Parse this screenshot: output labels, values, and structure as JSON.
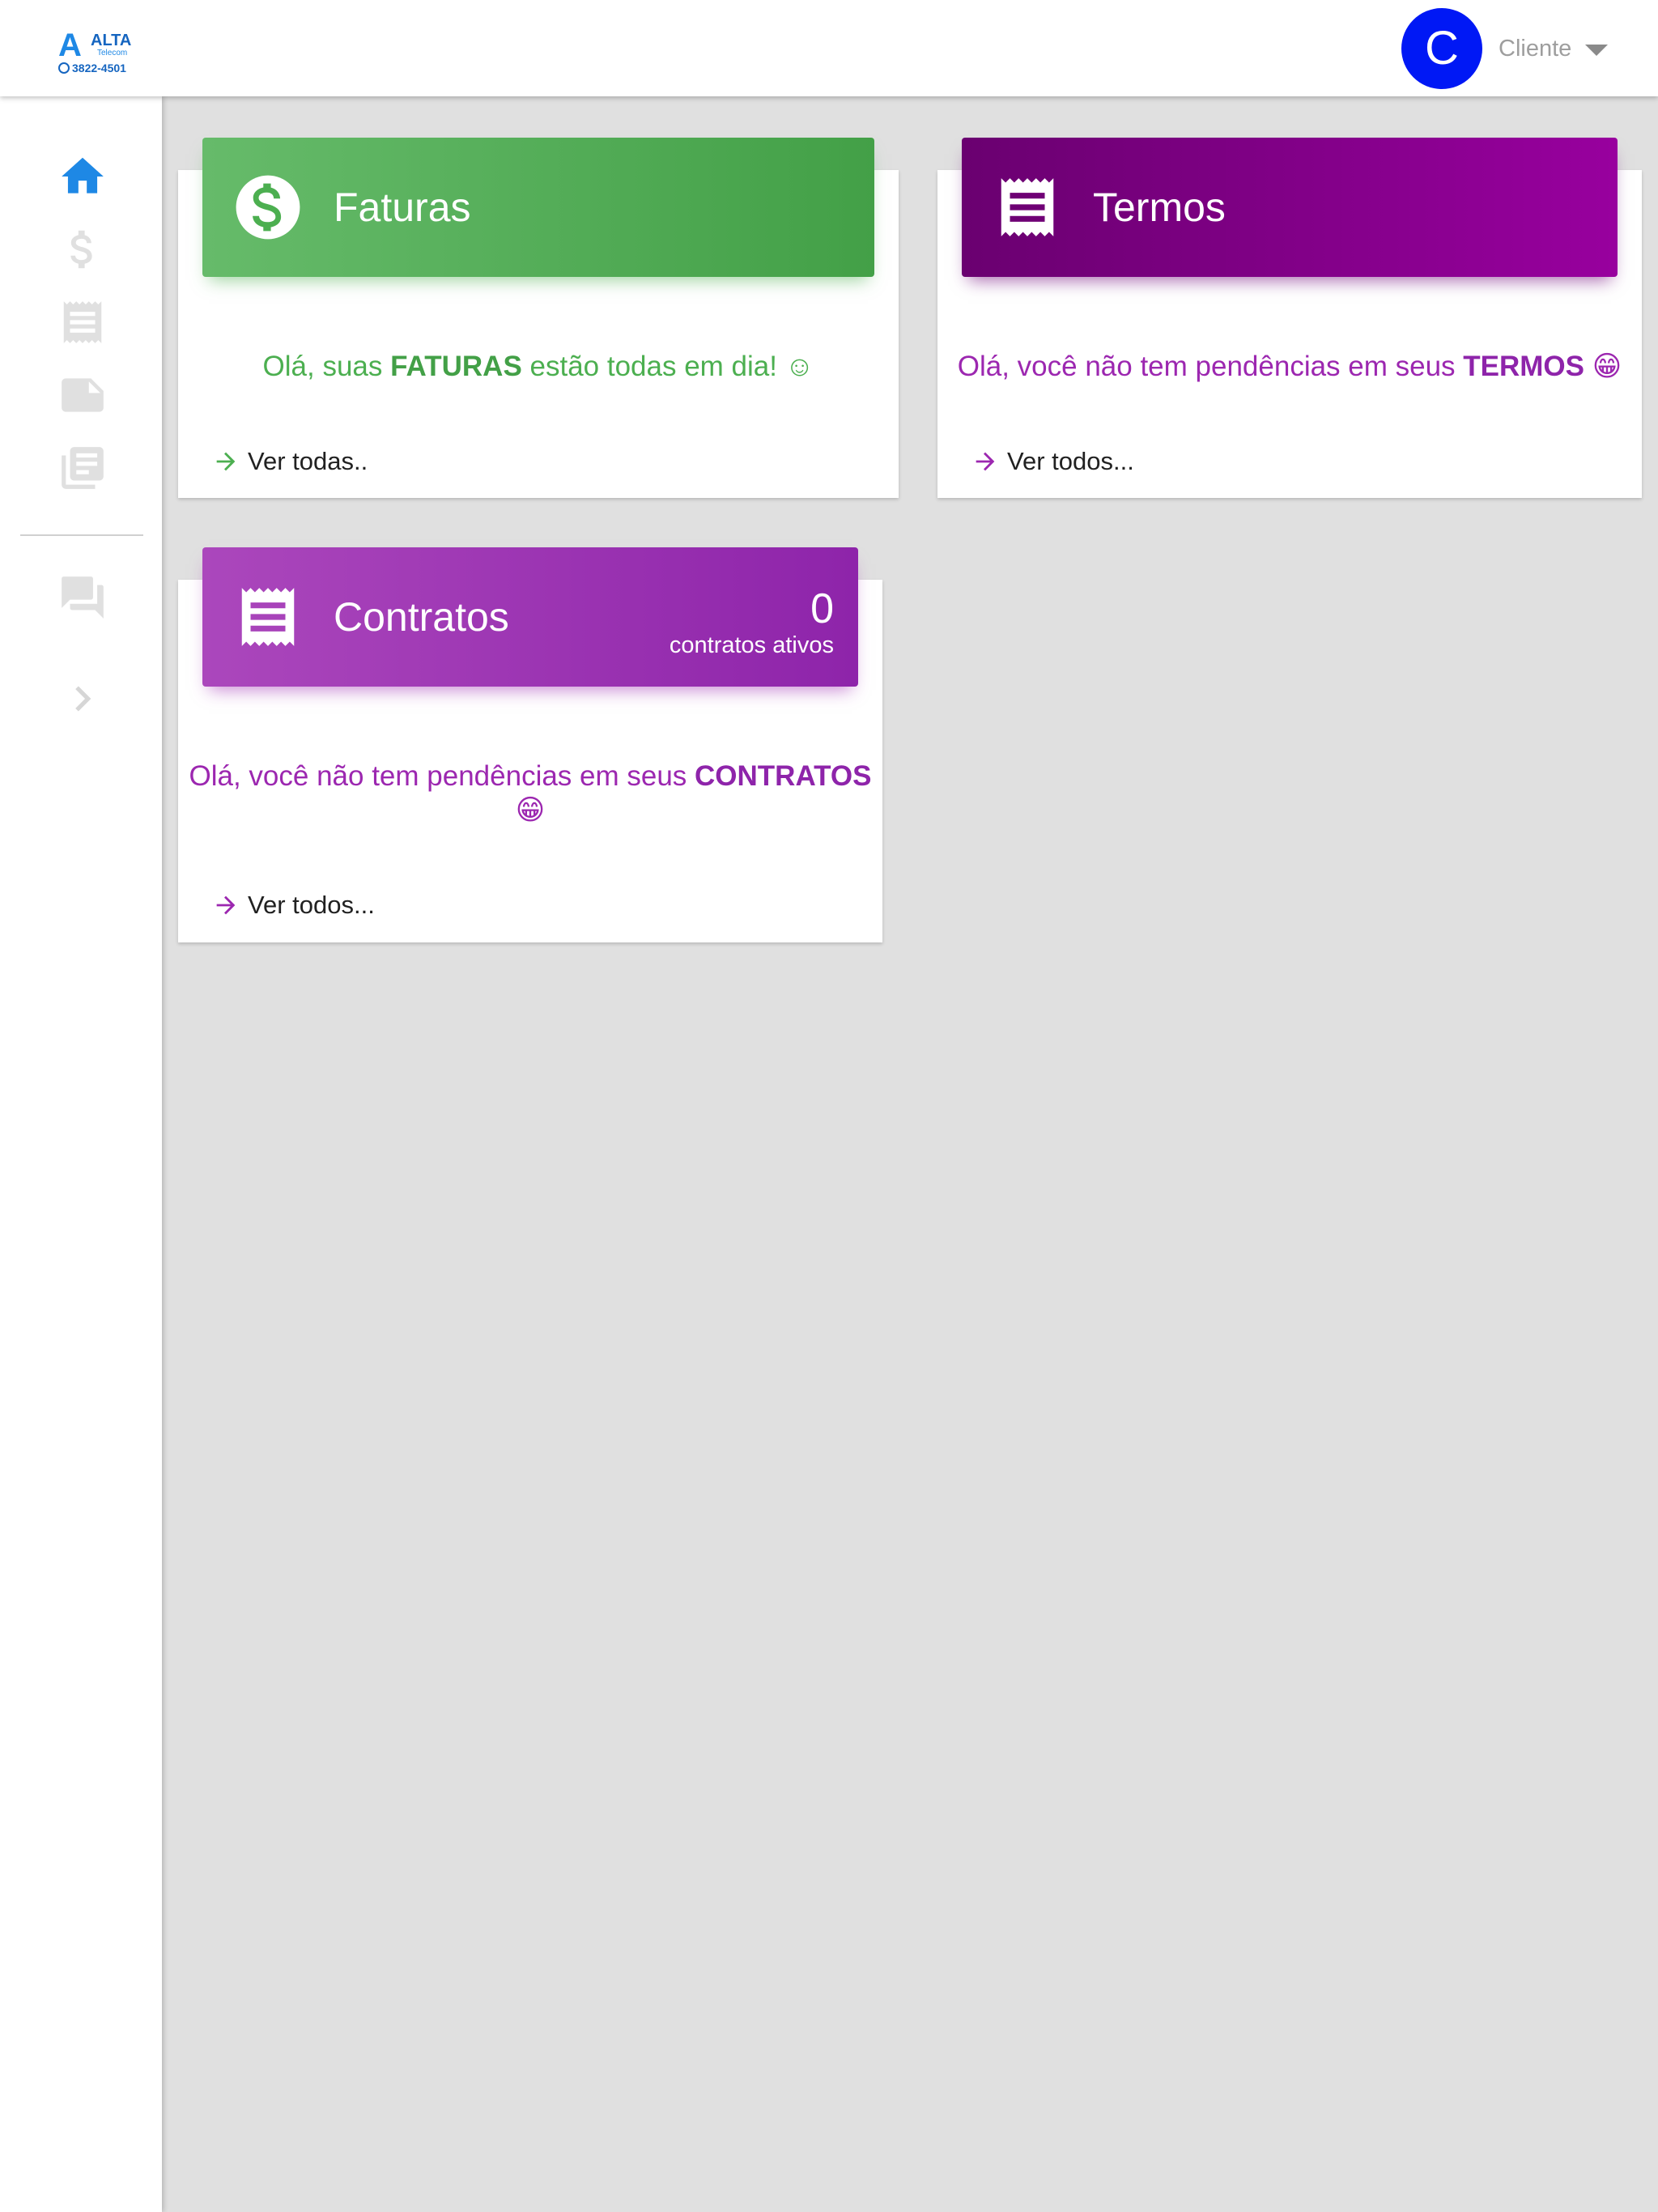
{
  "brand": {
    "name": "ALTA",
    "sub": "Telecom",
    "phone": "3822-4501"
  },
  "header": {
    "avatar_letter": "C",
    "user_label": "Cliente"
  },
  "sidebar": {
    "items": [
      {
        "icon": "home-icon",
        "active": true
      },
      {
        "icon": "dollar-icon",
        "active": false
      },
      {
        "icon": "receipt-icon",
        "active": false
      },
      {
        "icon": "note-icon",
        "active": false
      },
      {
        "icon": "library-icon",
        "active": false
      },
      {
        "icon": "chat-icon",
        "active": false
      },
      {
        "icon": "chevron-right-icon",
        "active": false
      }
    ]
  },
  "cards": {
    "faturas": {
      "title": "Faturas",
      "msg_before": "Olá, suas ",
      "msg_bold": "FATURAS",
      "msg_after": " estão todas em dia! ☺",
      "link": "Ver todas..",
      "color": "#4caf50"
    },
    "termos": {
      "title": "Termos",
      "msg_before": "Olá, você não tem pendências em seus ",
      "msg_bold": "TERMOS",
      "msg_after": " 😁",
      "link": "Ver todos...",
      "color": "#8e24aa"
    },
    "contratos": {
      "title": "Contratos",
      "count": "0",
      "count_label": "contratos ativos",
      "msg_before": "Olá, você não tem pendências em seus ",
      "msg_bold": "CONTRATOS",
      "msg_after": "😁",
      "link": "Ver todos...",
      "color": "#9c27b0"
    }
  },
  "colors": {
    "accent_blue": "#1e88e5",
    "avatar": "#0018f5",
    "faturas_green": "#4caf50",
    "termos_purple": "#800080",
    "contratos_purple": "#9c27b0"
  }
}
